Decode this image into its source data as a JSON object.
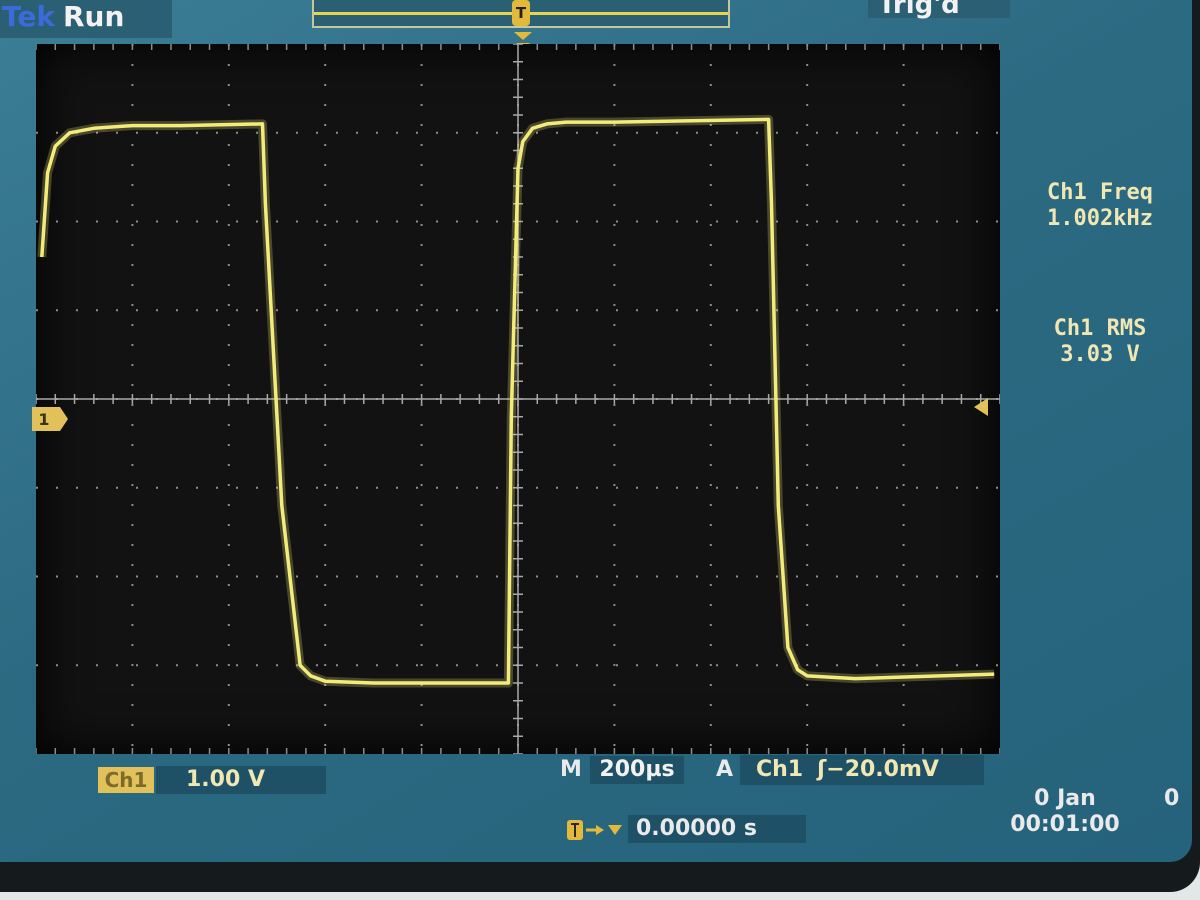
{
  "header": {
    "brand": "Tek",
    "acquisition_state": "Run",
    "trigger_status": "Trig'd"
  },
  "measurements": [
    {
      "label": "Ch1 Freq",
      "value": "1.002kHz"
    },
    {
      "label": "Ch1 RMS",
      "value": "3.03 V"
    }
  ],
  "channel": {
    "badge": "Ch1",
    "scale": "1.00 V",
    "ground_marker": "1"
  },
  "timebase": {
    "label": "M",
    "value": "200µs"
  },
  "trigger": {
    "label": "A",
    "source": "Ch1",
    "level": "ʃ−20.0mV",
    "marker": "T"
  },
  "horizontal_position": {
    "value": "0.00000 s"
  },
  "clock": {
    "date": "0 Jan",
    "time": "00:01:00",
    "extra": "0"
  },
  "colors": {
    "trace": "#f3ec7a",
    "screen_bg": "#2c6a82",
    "graticule_bg": "#121212",
    "grid_dots": "#8d8d8d",
    "accent": "#e3c15a"
  },
  "chart_data": {
    "type": "line",
    "title": "",
    "xlabel": "",
    "ylabel": "",
    "x_units": "µs",
    "y_units": "V",
    "xlim": [
      -1000,
      1000
    ],
    "ylim": [
      -4,
      4
    ],
    "grid": true,
    "series": [
      {
        "x": [
          -988,
          -976,
          -960,
          -930,
          -880,
          -800,
          -700,
          -530,
          -524,
          -490,
          -452,
          -430,
          -400,
          -300,
          -20,
          -14,
          0,
          10,
          30,
          60,
          100,
          200,
          520,
          526,
          540,
          560,
          580,
          600,
          700,
          988
        ],
        "y": [
          1.6,
          2.55,
          2.85,
          3.0,
          3.05,
          3.08,
          3.08,
          3.1,
          2.2,
          -1.2,
          -3.0,
          -3.12,
          -3.18,
          -3.2,
          -3.2,
          -0.2,
          2.6,
          2.9,
          3.05,
          3.1,
          3.12,
          3.12,
          3.15,
          2.2,
          -1.2,
          -2.8,
          -3.05,
          -3.12,
          -3.15,
          -3.1
        ]
      }
    ]
  }
}
